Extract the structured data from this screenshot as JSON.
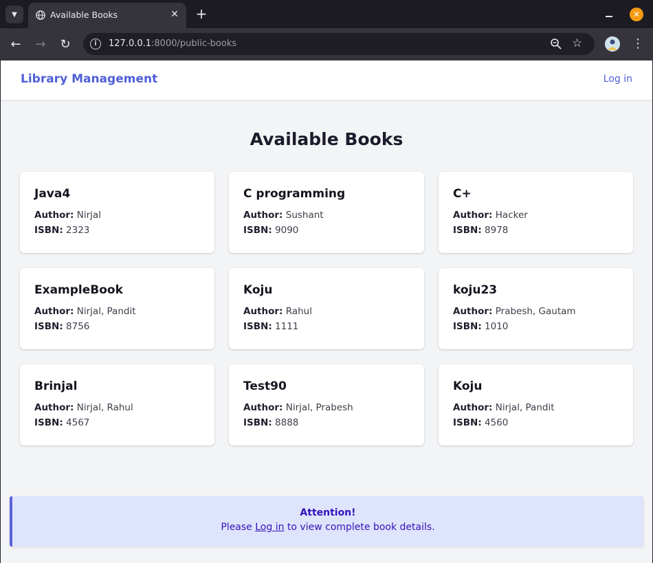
{
  "browser": {
    "tab_title": "Available Books",
    "url_host": "127.0.0.1",
    "url_rest": ":8000/public-books"
  },
  "navbar": {
    "brand": "Library Management",
    "login": "Log in"
  },
  "page": {
    "title": "Available Books",
    "author_label": "Author:",
    "isbn_label": "ISBN:"
  },
  "books": [
    {
      "title": "Java4",
      "author": "Nirjal",
      "isbn": "2323"
    },
    {
      "title": "C programming",
      "author": "Sushant",
      "isbn": "9090"
    },
    {
      "title": "C+",
      "author": "Hacker",
      "isbn": "8978"
    },
    {
      "title": "ExampleBook",
      "author": "Nirjal, Pandit",
      "isbn": "8756"
    },
    {
      "title": "Koju",
      "author": "Rahul",
      "isbn": "1111"
    },
    {
      "title": "koju23",
      "author": "Prabesh, Gautam",
      "isbn": "1010"
    },
    {
      "title": "Brinjal",
      "author": "Nirjal, Rahul",
      "isbn": "4567"
    },
    {
      "title": "Test90",
      "author": "Nirjal, Prabesh",
      "isbn": "8888"
    },
    {
      "title": "Koju",
      "author": "Nirjal, Pandit",
      "isbn": "4560"
    }
  ],
  "alert": {
    "title": "Attention!",
    "prefix": "Please",
    "link": "Log in",
    "suffix": "to view complete book details."
  },
  "colors": {
    "brand": "#4f5fd8",
    "alert_bg": "#dfe4fd",
    "alert_text": "#3212b8"
  }
}
